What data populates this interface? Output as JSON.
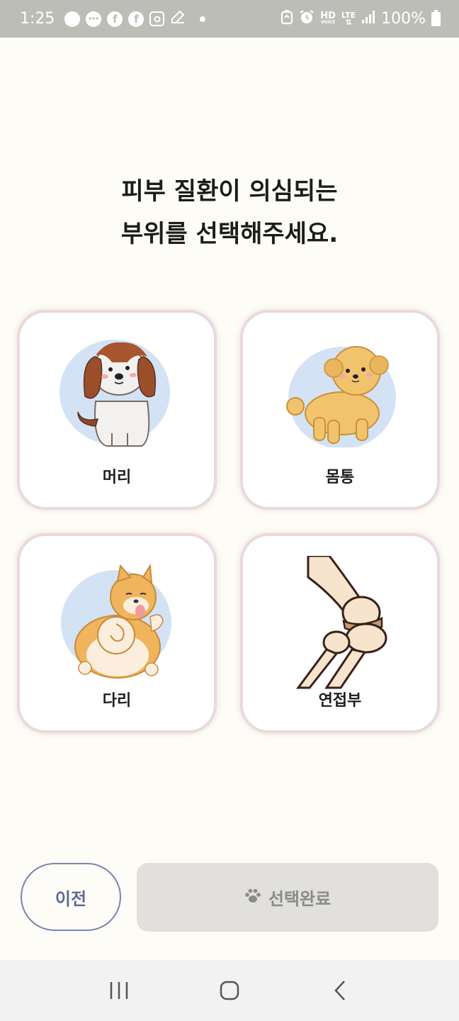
{
  "status_bar": {
    "time": "1:25",
    "battery": "100%",
    "icons": [
      "talk-icon",
      "chat-icon",
      "facebook-icon",
      "facebook-icon",
      "instagram-icon",
      "edit-icon",
      "dot",
      "alarm-clock-icon",
      "alarm-icon",
      "hd-voice-icon",
      "lte-icon",
      "signal-icon",
      "battery-icon"
    ],
    "hd_label": "HD",
    "voice_label": "VOICE",
    "lte_label": "LTE"
  },
  "title": {
    "line1": "피부 질환이 의심되는",
    "line2": "부위를 선택해주세요."
  },
  "options": [
    {
      "label": "머리",
      "icon": "beagle-dog-icon"
    },
    {
      "label": "몸통",
      "icon": "poodle-dog-icon"
    },
    {
      "label": "다리",
      "icon": "shiba-dog-icon"
    },
    {
      "label": "연접부",
      "icon": "joint-bone-icon"
    }
  ],
  "buttons": {
    "prev": "이전",
    "done": "선택완료",
    "done_icon": "paw-icon"
  },
  "nav": {
    "items": [
      "recent-apps-icon",
      "home-icon",
      "back-icon"
    ]
  },
  "colors": {
    "background": "#fdfcf6",
    "card_border": "#ead9dc",
    "prev_border": "#7c84b3",
    "done_bg": "#e1e0dc",
    "art_blue": "#d3e2f4"
  }
}
